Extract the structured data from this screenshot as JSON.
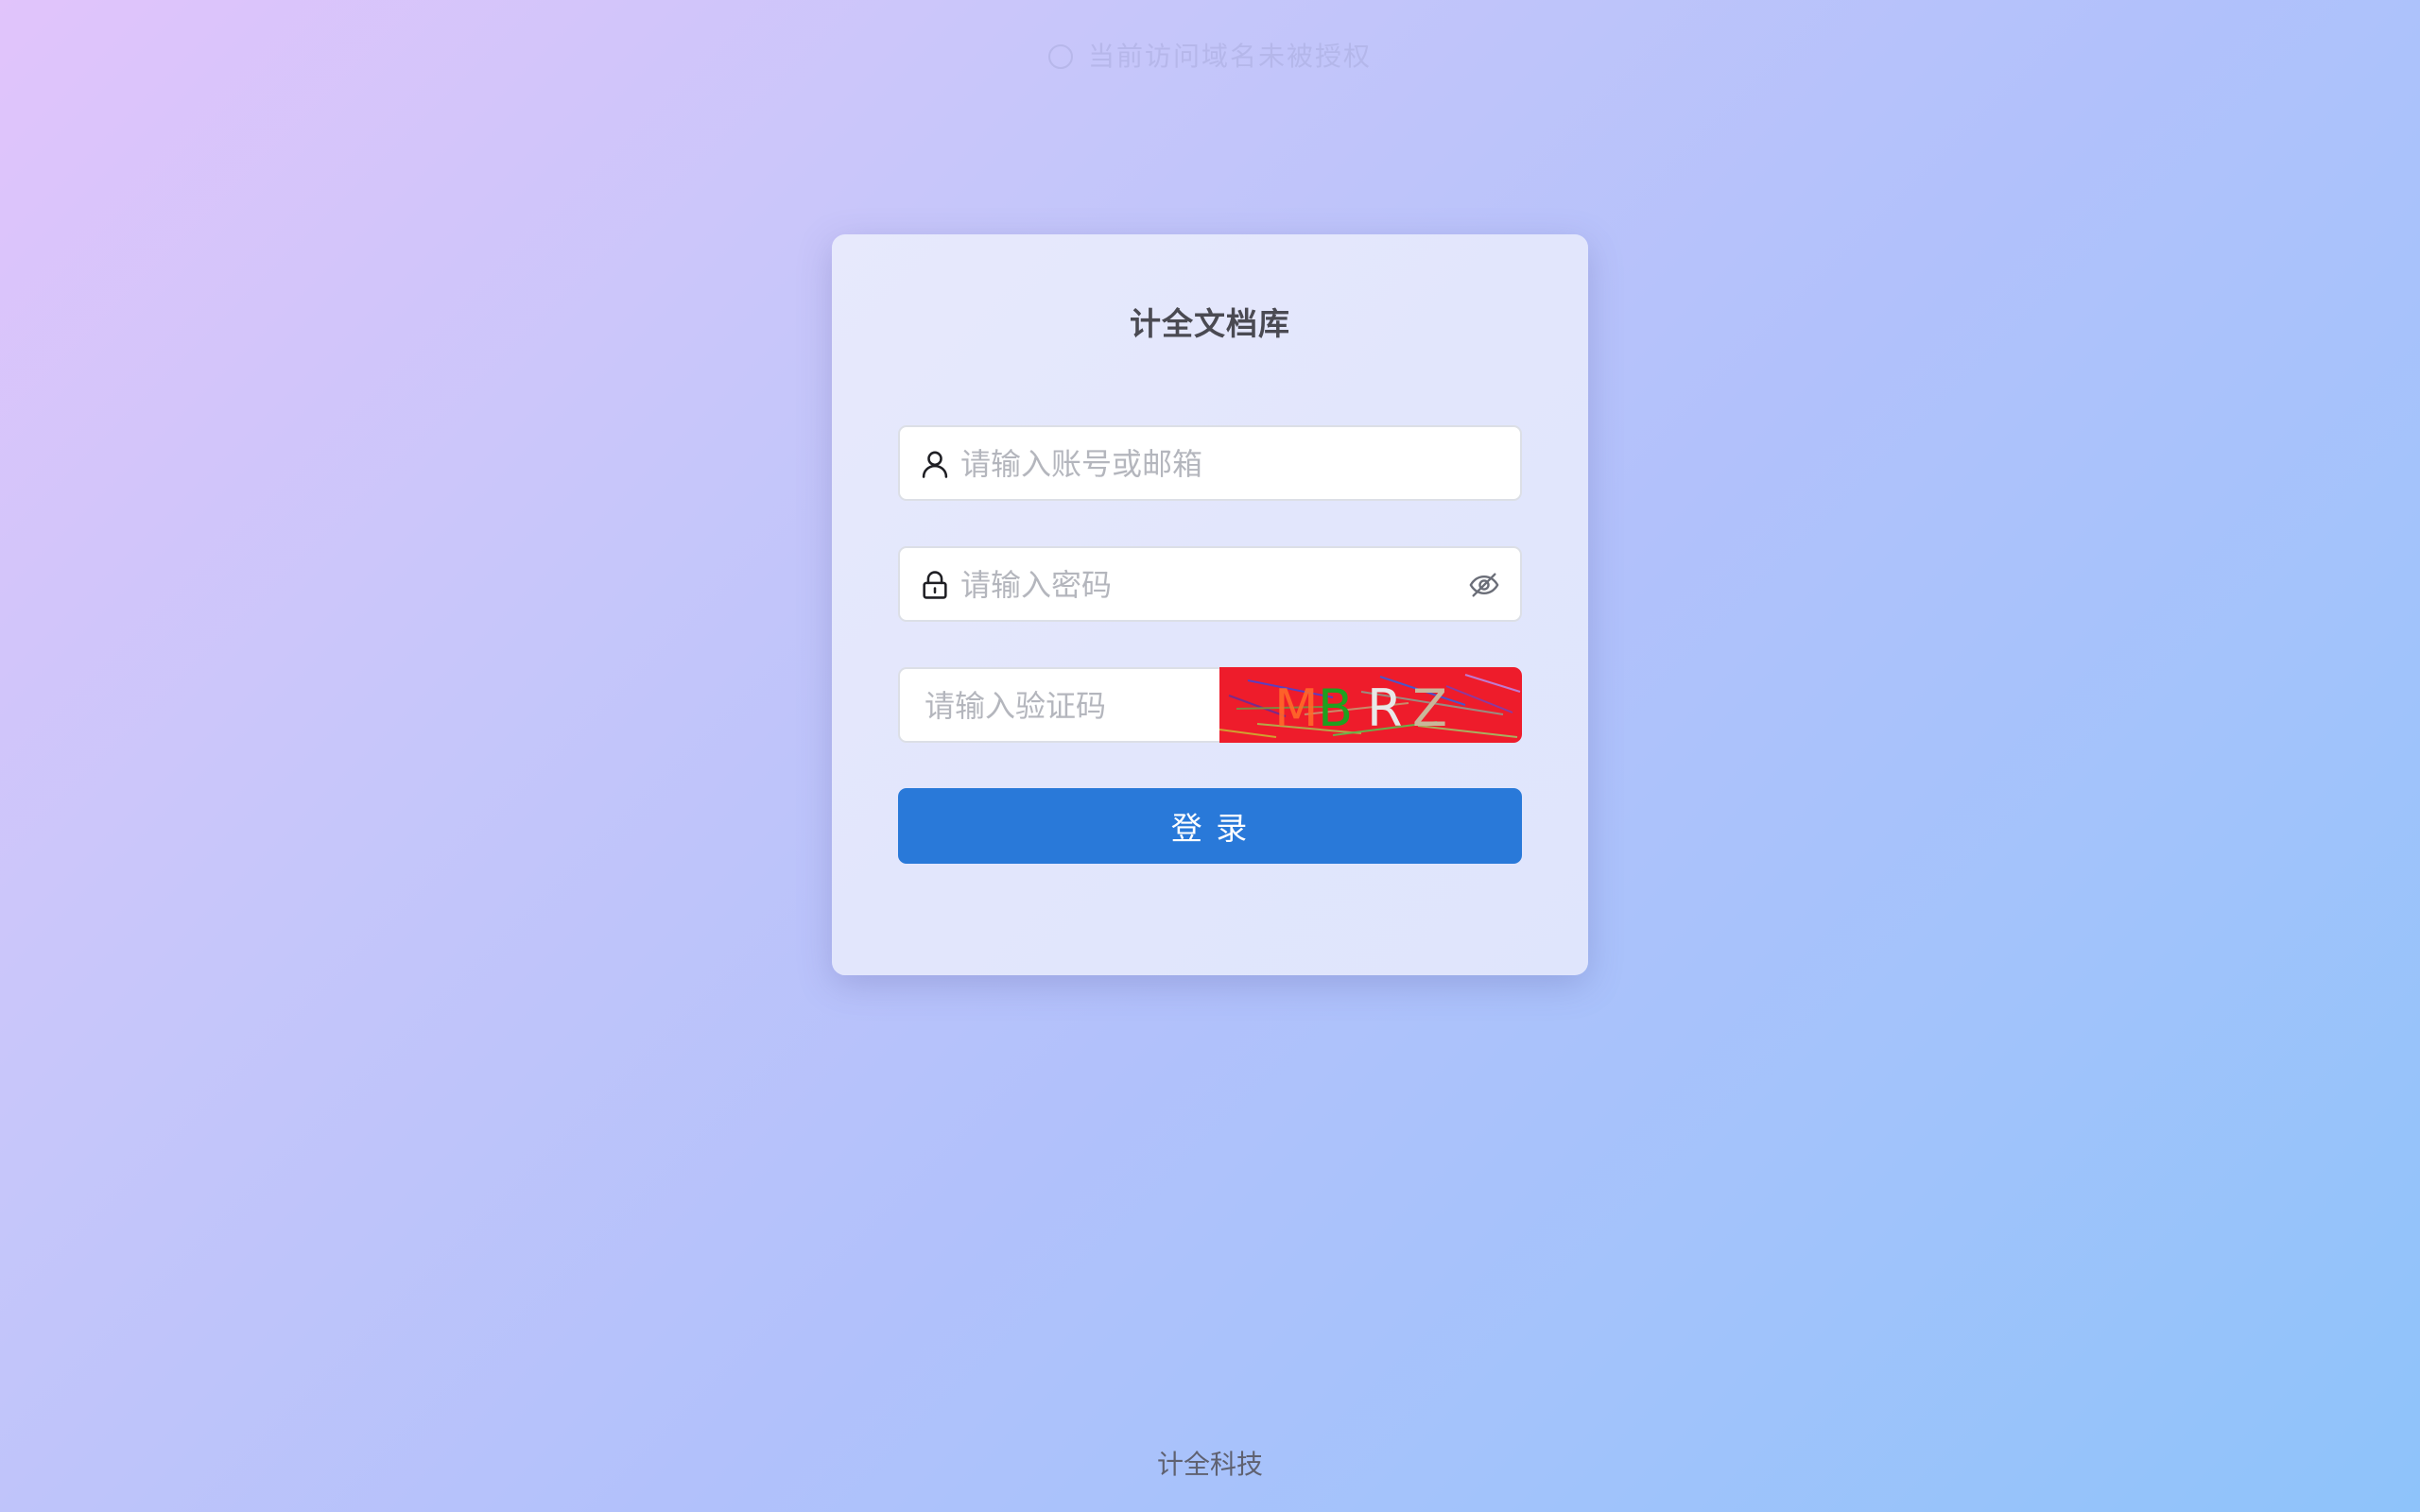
{
  "notice": {
    "text": "当前访问域名未被授权",
    "icon": "info-icon"
  },
  "login": {
    "title": "计全文档库",
    "username_placeholder": "请输入账号或邮箱",
    "username_icon": "user-icon",
    "password_placeholder": "请输入密码",
    "password_icon": "lock-icon",
    "password_toggle_icon": "eye-off-icon",
    "captcha_placeholder": "请输入验证码",
    "captcha_text": "MBRZ",
    "captcha_bg": "#ee1c2b",
    "submit_label": "登 录",
    "submit_color": "#2979d9"
  },
  "footer": {
    "text": "计全科技"
  }
}
